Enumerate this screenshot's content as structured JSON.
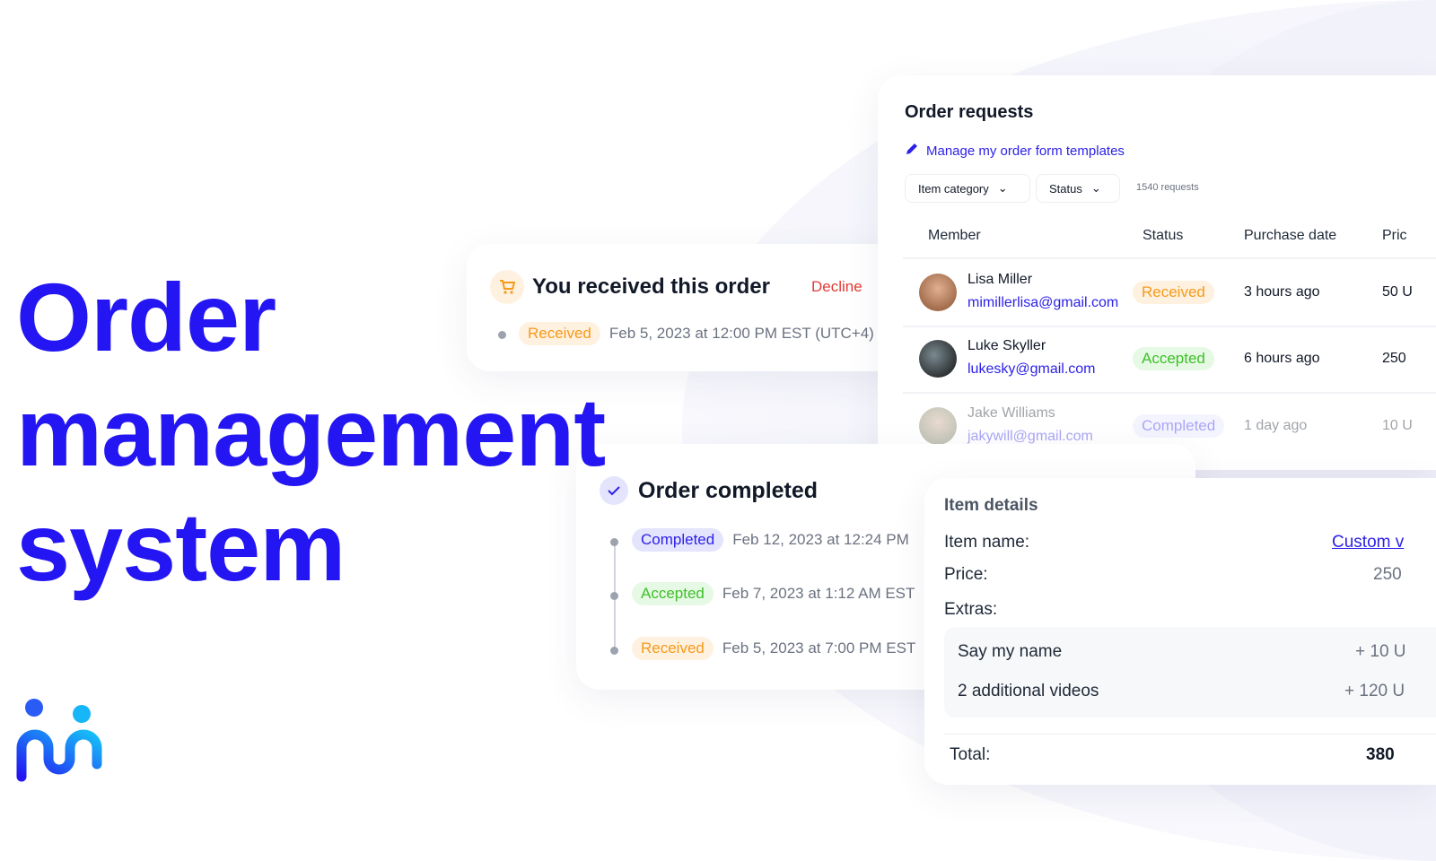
{
  "hero": {
    "line1": "Order",
    "line2": "management",
    "line3": "system"
  },
  "colors": {
    "brand": "#2416f2",
    "received": "#f59a1b",
    "accepted": "#3fbf2a",
    "completed": "#2d21e8",
    "decline": "#e53935"
  },
  "order_requests": {
    "title": "Order requests",
    "manage_link": "Manage my order form templates",
    "filters": [
      "Item category",
      "Status"
    ],
    "count": "1540 requests",
    "columns": [
      "Member",
      "Status",
      "Purchase date",
      "Pric"
    ],
    "rows": [
      {
        "name": "Lisa Miller",
        "email": "mimillerlisa@gmail.com",
        "status": "Received",
        "date": "3 hours ago",
        "price": "50 U"
      },
      {
        "name": "Luke Skyller",
        "email": "lukesky@gmail.com",
        "status": "Accepted",
        "date": "6 hours ago",
        "price": "250"
      },
      {
        "name": "Jake Williams",
        "email": "jakywill@gmail.com",
        "status": "Completed",
        "date": "1 day ago",
        "price": "10 U"
      }
    ]
  },
  "received_card": {
    "title": "You received this order",
    "decline": "Decline",
    "status": "Received",
    "date": "Feb 5, 2023 at 12:00 PM EST (UTC+4)",
    "icon": "cart-icon"
  },
  "completed_card": {
    "title": "Order completed",
    "icon": "check-icon",
    "timeline": [
      {
        "status": "Completed",
        "date": "Feb 12, 2023 at 12:24 PM"
      },
      {
        "status": "Accepted",
        "date": "Feb 7, 2023 at 1:12 AM EST"
      },
      {
        "status": "Received",
        "date": "Feb 5, 2023 at 7:00 PM EST"
      }
    ]
  },
  "item_details": {
    "title": "Item details",
    "item_name_label": "Item name:",
    "item_name": "Custom v",
    "price_label": "Price:",
    "price": "250",
    "extras_label": "Extras:",
    "extras": [
      {
        "name": "Say my name",
        "price": "+ 10 U"
      },
      {
        "name": "2 additional videos",
        "price": "+ 120 U"
      }
    ],
    "total_label": "Total:",
    "total": "380"
  }
}
